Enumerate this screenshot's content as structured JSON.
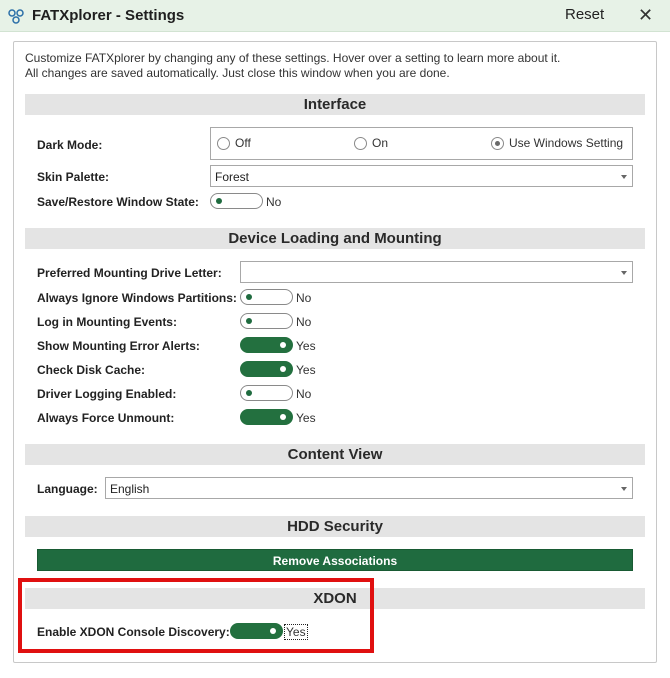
{
  "window": {
    "title": "FATXplorer - Settings",
    "reset_label": "Reset",
    "close_label": "✕"
  },
  "intro": {
    "line1": "Customize FATXplorer by changing any of these settings. Hover over a setting to learn more about it.",
    "line2": "All changes are saved automatically. Just close this window when you are done."
  },
  "interface": {
    "header": "Interface",
    "dark_mode": {
      "label": "Dark Mode:",
      "options": [
        "Off",
        "On",
        "Use Windows Setting"
      ],
      "selected": "Use Windows Setting"
    },
    "skin_palette": {
      "label": "Skin Palette:",
      "value": "Forest"
    },
    "save_restore": {
      "label": "Save/Restore Window State:",
      "state": "No",
      "on": false
    }
  },
  "device": {
    "header": "Device Loading and Mounting",
    "drive_letter": {
      "label": "Preferred Mounting Drive Letter:",
      "value": ""
    },
    "toggles": [
      {
        "label": "Always Ignore Windows Partitions:",
        "state": "No",
        "on": false
      },
      {
        "label": "Log in Mounting Events:",
        "state": "No",
        "on": false
      },
      {
        "label": "Show Mounting Error Alerts:",
        "state": "Yes",
        "on": true
      },
      {
        "label": "Check Disk Cache:",
        "state": "Yes",
        "on": true
      },
      {
        "label": "Driver Logging Enabled:",
        "state": "No",
        "on": false
      },
      {
        "label": "Always Force Unmount:",
        "state": "Yes",
        "on": true
      }
    ]
  },
  "content_view": {
    "header": "Content View",
    "language": {
      "label": "Language:",
      "value": "English"
    }
  },
  "hdd_security": {
    "header": "HDD Security",
    "remove_button": "Remove Associations"
  },
  "xdon": {
    "header": "XDON",
    "discovery": {
      "label": "Enable XDON Console Discovery:",
      "state": "Yes",
      "on": true
    }
  },
  "colors": {
    "accent_green": "#23703f",
    "titlebar_bg": "#e7f2e7",
    "highlight_red": "#e01010"
  }
}
